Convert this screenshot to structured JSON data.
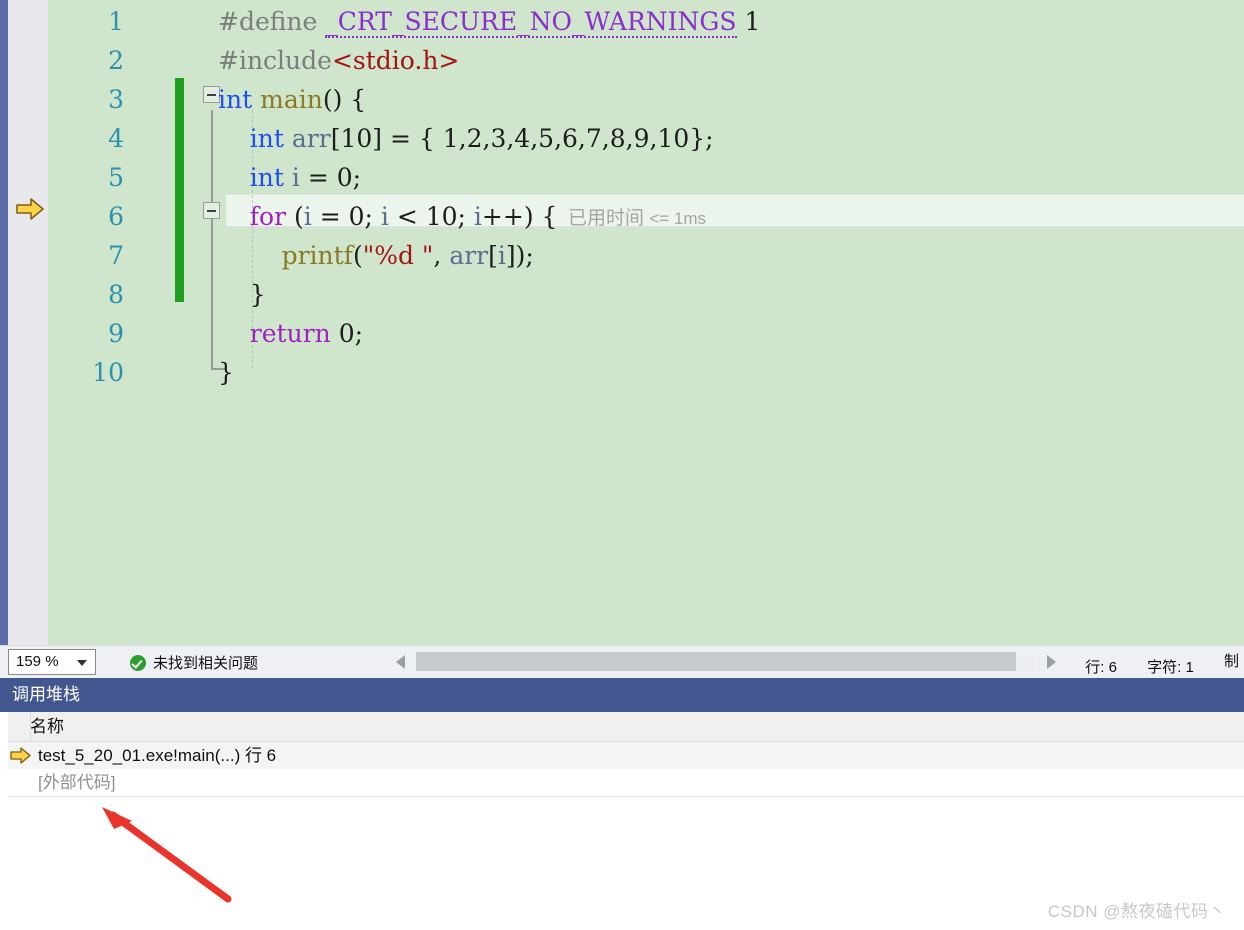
{
  "editor": {
    "zoom_level": "159 %",
    "line_numbers": [
      "1",
      "2",
      "3",
      "4",
      "5",
      "6",
      "7",
      "8",
      "9",
      "10"
    ],
    "code_lines": [
      {
        "n": 1,
        "tokens": [
          {
            "t": "#define ",
            "c": "c-pre"
          },
          {
            "t": "_CRT_SECURE_NO_WARNINGS",
            "c": "c-macro squig"
          },
          {
            "t": " ",
            "c": "c-plain"
          },
          {
            "t": "1",
            "c": "c-num"
          }
        ]
      },
      {
        "n": 2,
        "tokens": [
          {
            "t": "#include",
            "c": "c-pre"
          },
          {
            "t": "<stdio.h>",
            "c": "c-hdr"
          }
        ]
      },
      {
        "n": 3,
        "tokens": [
          {
            "t": "int",
            "c": "c-kw"
          },
          {
            "t": " ",
            "c": "c-plain"
          },
          {
            "t": "main",
            "c": "c-func"
          },
          {
            "t": "() {",
            "c": "c-plain"
          }
        ]
      },
      {
        "n": 4,
        "tokens": [
          {
            "t": "    ",
            "c": "c-plain"
          },
          {
            "t": "int",
            "c": "c-kw"
          },
          {
            "t": " ",
            "c": "c-plain"
          },
          {
            "t": "arr",
            "c": "c-ident"
          },
          {
            "t": "[",
            "c": "c-plain"
          },
          {
            "t": "10",
            "c": "c-num"
          },
          {
            "t": "] = { ",
            "c": "c-plain"
          },
          {
            "t": "1,2,3,4,5,6,7,8,9,10",
            "c": "c-num"
          },
          {
            "t": "};",
            "c": "c-plain"
          }
        ]
      },
      {
        "n": 5,
        "tokens": [
          {
            "t": "    ",
            "c": "c-plain"
          },
          {
            "t": "int",
            "c": "c-kw"
          },
          {
            "t": " ",
            "c": "c-plain"
          },
          {
            "t": "i",
            "c": "c-ident"
          },
          {
            "t": " = ",
            "c": "c-plain"
          },
          {
            "t": "0",
            "c": "c-num"
          },
          {
            "t": ";",
            "c": "c-plain"
          }
        ]
      },
      {
        "n": 6,
        "tokens": [
          {
            "t": "    ",
            "c": "c-plain"
          },
          {
            "t": "for",
            "c": "c-ctrl"
          },
          {
            "t": " (",
            "c": "c-plain"
          },
          {
            "t": "i",
            "c": "c-ident"
          },
          {
            "t": " = ",
            "c": "c-plain"
          },
          {
            "t": "0",
            "c": "c-num"
          },
          {
            "t": "; ",
            "c": "c-plain"
          },
          {
            "t": "i",
            "c": "c-ident"
          },
          {
            "t": " < ",
            "c": "c-plain"
          },
          {
            "t": "10",
            "c": "c-num"
          },
          {
            "t": "; ",
            "c": "c-plain"
          },
          {
            "t": "i",
            "c": "c-ident"
          },
          {
            "t": "++) {",
            "c": "c-plain"
          }
        ]
      },
      {
        "n": 7,
        "tokens": [
          {
            "t": "        ",
            "c": "c-plain"
          },
          {
            "t": "printf",
            "c": "c-func"
          },
          {
            "t": "(",
            "c": "c-plain"
          },
          {
            "t": "\"%d \"",
            "c": "c-str"
          },
          {
            "t": ", ",
            "c": "c-plain"
          },
          {
            "t": "arr",
            "c": "c-ident"
          },
          {
            "t": "[",
            "c": "c-plain"
          },
          {
            "t": "i",
            "c": "c-ident"
          },
          {
            "t": "]);",
            "c": "c-plain"
          }
        ]
      },
      {
        "n": 8,
        "tokens": [
          {
            "t": "    }",
            "c": "c-plain"
          }
        ]
      },
      {
        "n": 9,
        "tokens": [
          {
            "t": "    ",
            "c": "c-plain"
          },
          {
            "t": "return",
            "c": "c-ctrl"
          },
          {
            "t": " ",
            "c": "c-plain"
          },
          {
            "t": "0",
            "c": "c-num"
          },
          {
            "t": ";",
            "c": "c-plain"
          }
        ]
      },
      {
        "n": 10,
        "tokens": [
          {
            "t": "}",
            "c": "c-plain"
          }
        ]
      }
    ],
    "elapsed_hint_cjk": "已用时间",
    "elapsed_hint_value": "<= 1ms",
    "current_line": 6
  },
  "statusbar": {
    "problems_text": "未找到相关问题",
    "line_label": "行: 6",
    "char_label": "字符: 1",
    "extra_label": "制"
  },
  "callstack": {
    "title": "调用堆栈",
    "column_header": "名称",
    "rows": [
      {
        "text": "test_5_20_01.exe!main(...) 行 6",
        "active": true
      },
      {
        "text": "[外部代码]",
        "active": false
      }
    ]
  },
  "watermark": "CSDN @熬夜磕代码丶",
  "colors": {
    "editor_bg": "#cfe6cd",
    "panel_title_bg": "#42568f",
    "change_bar": "#1e9e1e",
    "left_strip": "#5b6ea8",
    "annotation_arrow": "#e8342a",
    "keyword": "#1f4ef5",
    "macro": "#8c2ecd",
    "string": "#a31515",
    "linenumber": "#2b91af"
  }
}
